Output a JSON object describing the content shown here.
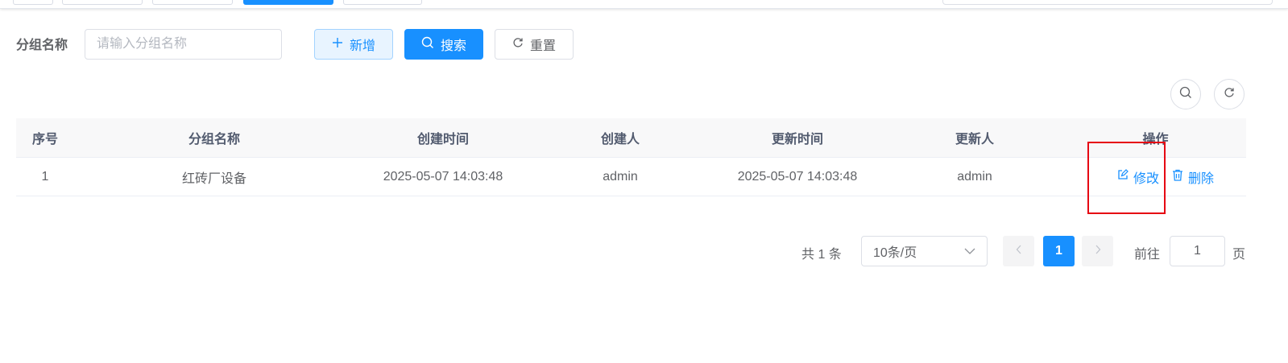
{
  "search_form": {
    "label": "分组名称",
    "input_placeholder": "请输入分组名称",
    "input_value": "",
    "add_label": "新增",
    "search_label": "搜索",
    "reset_label": "重置"
  },
  "table": {
    "columns": [
      "序号",
      "分组名称",
      "创建时间",
      "创建人",
      "更新时间",
      "更新人",
      "操作"
    ],
    "rows": [
      {
        "index": "1",
        "name": "红砖厂设备",
        "created_at": "2025-05-07 14:03:48",
        "created_by": "admin",
        "updated_at": "2025-05-07 14:03:48",
        "updated_by": "admin",
        "edit_label": "修改",
        "delete_label": "删除"
      }
    ]
  },
  "pagination": {
    "total_text": "共 1 条",
    "page_size": "10条/页",
    "current_page": "1",
    "goto_label": "前往",
    "goto_value": "1",
    "page_unit": "页"
  },
  "colors": {
    "primary": "#1890ff",
    "highlight_box": "#e60012"
  },
  "icons": {
    "add": "plus-icon",
    "search": "search-icon",
    "reset": "refresh-icon",
    "edit": "edit-icon",
    "delete": "trash-icon",
    "prev": "chevron-left-icon",
    "next": "chevron-right-icon",
    "dropdown": "chevron-down-icon"
  }
}
